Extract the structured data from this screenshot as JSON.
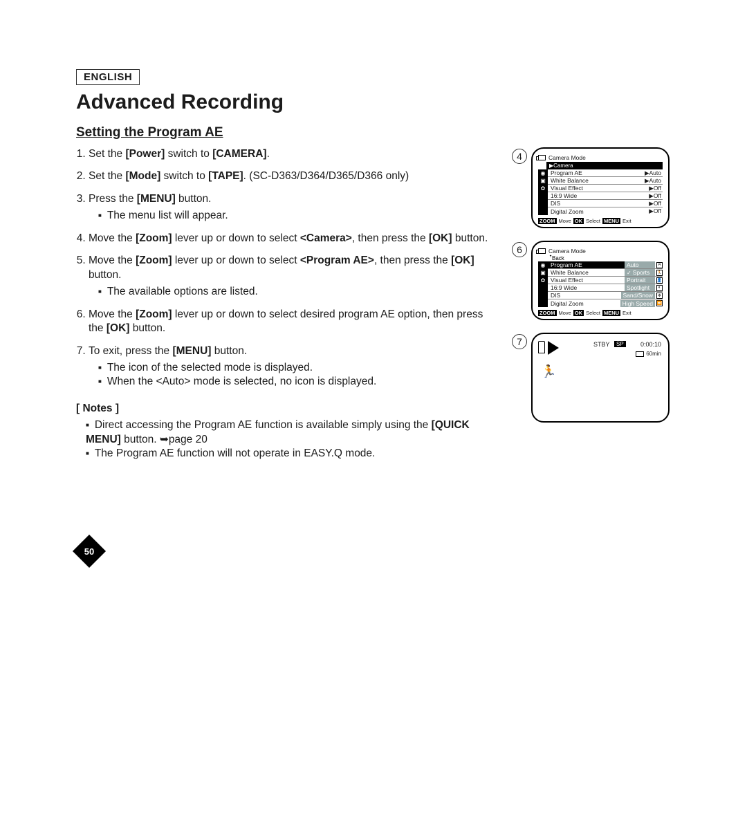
{
  "lang": "ENGLISH",
  "title": "Advanced Recording",
  "subtitle": "Setting the Program AE",
  "steps": [
    {
      "pre": "Set the ",
      "b1": "[Power]",
      "mid": " switch to ",
      "b2": "[CAMERA]",
      "post": "."
    },
    {
      "pre": "Set the ",
      "b1": "[Mode]",
      "mid": " switch to ",
      "b2": "[TAPE]",
      "post": ". (SC-D363/D364/D365/D366 only)"
    },
    {
      "pre": "Press the ",
      "b1": "[MENU]",
      "mid": " button.",
      "sub": [
        "The menu list will appear."
      ]
    },
    {
      "pre": "Move the ",
      "b1": "[Zoom]",
      "mid": " lever up or down to select ",
      "b2": "<Camera>",
      "post": ", then press the ",
      "b3": "[OK]",
      "post2": " button."
    },
    {
      "pre": "Move the ",
      "b1": "[Zoom]",
      "mid": " lever up or down to select ",
      "b2": "<Program AE>",
      "post": ", then press the ",
      "b3": "[OK]",
      "post2": " button.",
      "sub": [
        "The available options are listed."
      ]
    },
    {
      "pre": "Move the ",
      "b1": "[Zoom]",
      "mid": " lever up or down to select desired program AE option,  then press the ",
      "b2": "[OK]",
      "post": " button."
    },
    {
      "pre": "To exit, press the ",
      "b1": "[MENU]",
      "mid": " button.",
      "sub": [
        "The icon of the selected mode is displayed.",
        "When the <Auto> mode is selected, no icon is displayed."
      ]
    }
  ],
  "notes_hd": "[ Notes ]",
  "notes": [
    {
      "t1": "Direct accessing the Program AE function is available simply using the ",
      "b": "[QUICK MENU]",
      "t2": " button. ➥page 20"
    },
    {
      "t1": "The Program AE function will not operate in EASY.Q mode."
    }
  ],
  "page_num": "50",
  "screens": {
    "s4": {
      "num": "4",
      "title": "Camera Mode",
      "sub": "▶Camera",
      "rows": [
        {
          "label": "Program AE",
          "val": "▶Auto"
        },
        {
          "label": "White Balance",
          "val": "▶Auto"
        },
        {
          "label": "Visual Effect",
          "val": "▶Off"
        },
        {
          "label": "16:9 Wide",
          "val": "▶Off"
        },
        {
          "label": "DIS",
          "val": "▶Off"
        },
        {
          "label": "Digital Zoom",
          "val": "▶Off"
        }
      ],
      "nav": {
        "zoom": "ZOOM",
        "move": "Move",
        "ok": "OK",
        "select": "Select",
        "menu": "MENU",
        "exit": "Exit"
      }
    },
    "s6": {
      "num": "6",
      "title": "Camera Mode",
      "sub": "ꜛBack",
      "rows": [
        {
          "label": "Program AE",
          "val": "Auto",
          "ico": "A",
          "hl": true
        },
        {
          "label": "White Balance",
          "val": "Sports",
          "ico": "🏃",
          "chk": true
        },
        {
          "label": "Visual Effect",
          "val": "Portrait",
          "ico": "👤"
        },
        {
          "label": "16:9 Wide",
          "val": "Spotlight",
          "ico": "◐"
        },
        {
          "label": "DIS",
          "val": "Sand/Snow",
          "ico": "❄"
        },
        {
          "label": "Digital Zoom",
          "val": "High Speed",
          "ico": "⏩"
        }
      ],
      "nav": {
        "zoom": "ZOOM",
        "move": "Move",
        "ok": "OK",
        "select": "Select",
        "menu": "MENU",
        "exit": "Exit"
      }
    },
    "s7": {
      "num": "7",
      "stby": "STBY",
      "sp": "SP",
      "time": "0:00:10",
      "min": "60min"
    }
  }
}
